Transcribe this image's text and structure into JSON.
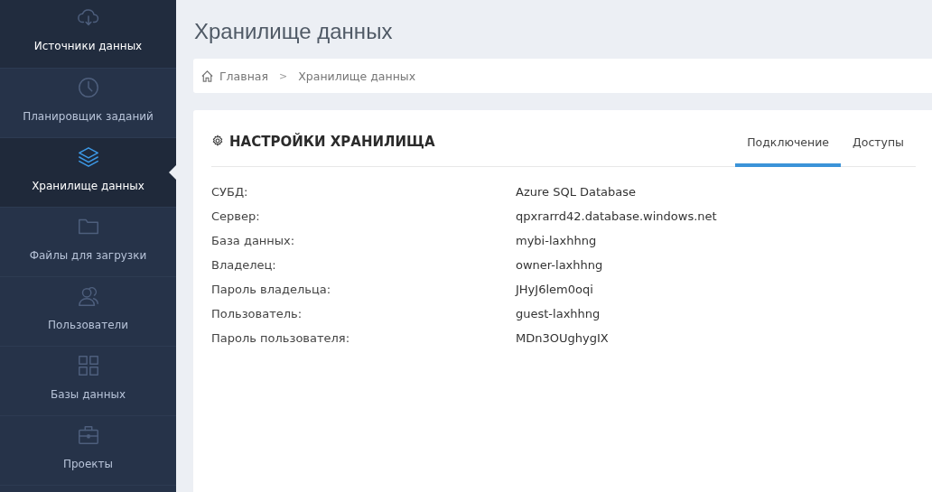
{
  "sidebar": {
    "items": [
      {
        "label": "Источники данных",
        "selected": false,
        "highlighted": true
      },
      {
        "label": "Планировщик заданий",
        "selected": false,
        "highlighted": false
      },
      {
        "label": "Хранилище данных",
        "selected": true,
        "highlighted": false
      },
      {
        "label": "Файлы для загрузки",
        "selected": false,
        "highlighted": false
      },
      {
        "label": "Пользователи",
        "selected": false,
        "highlighted": false
      },
      {
        "label": "Базы данных",
        "selected": false,
        "highlighted": false
      },
      {
        "label": "Проекты",
        "selected": false,
        "highlighted": false
      }
    ]
  },
  "page_title": "Хранилище данных",
  "breadcrumbs": [
    "Главная",
    "Хранилище данных"
  ],
  "breadcrumb_separator": ">",
  "panel": {
    "title": "НАСТРОЙКИ ХРАНИЛИЩА",
    "tabs": [
      {
        "label": "Подключение",
        "selected": true
      },
      {
        "label": "Доступы",
        "selected": false
      }
    ],
    "fields": [
      {
        "label": "СУБД:",
        "value": "Azure SQL Database"
      },
      {
        "label": "Сервер:",
        "value": "qpxrarrd42.database.windows.net"
      },
      {
        "label": "База данных:",
        "value": "mybi-laxhhng"
      },
      {
        "label": "Владелец:",
        "value": "owner-laxhhng"
      },
      {
        "label": "Пароль владельца:",
        "value": "JHyJ6lem0oqi"
      },
      {
        "label": "Пользователь:",
        "value": "guest-laxhhng"
      },
      {
        "label": "Пароль пользователя:",
        "value": "MDn3OUghygIX"
      }
    ]
  }
}
